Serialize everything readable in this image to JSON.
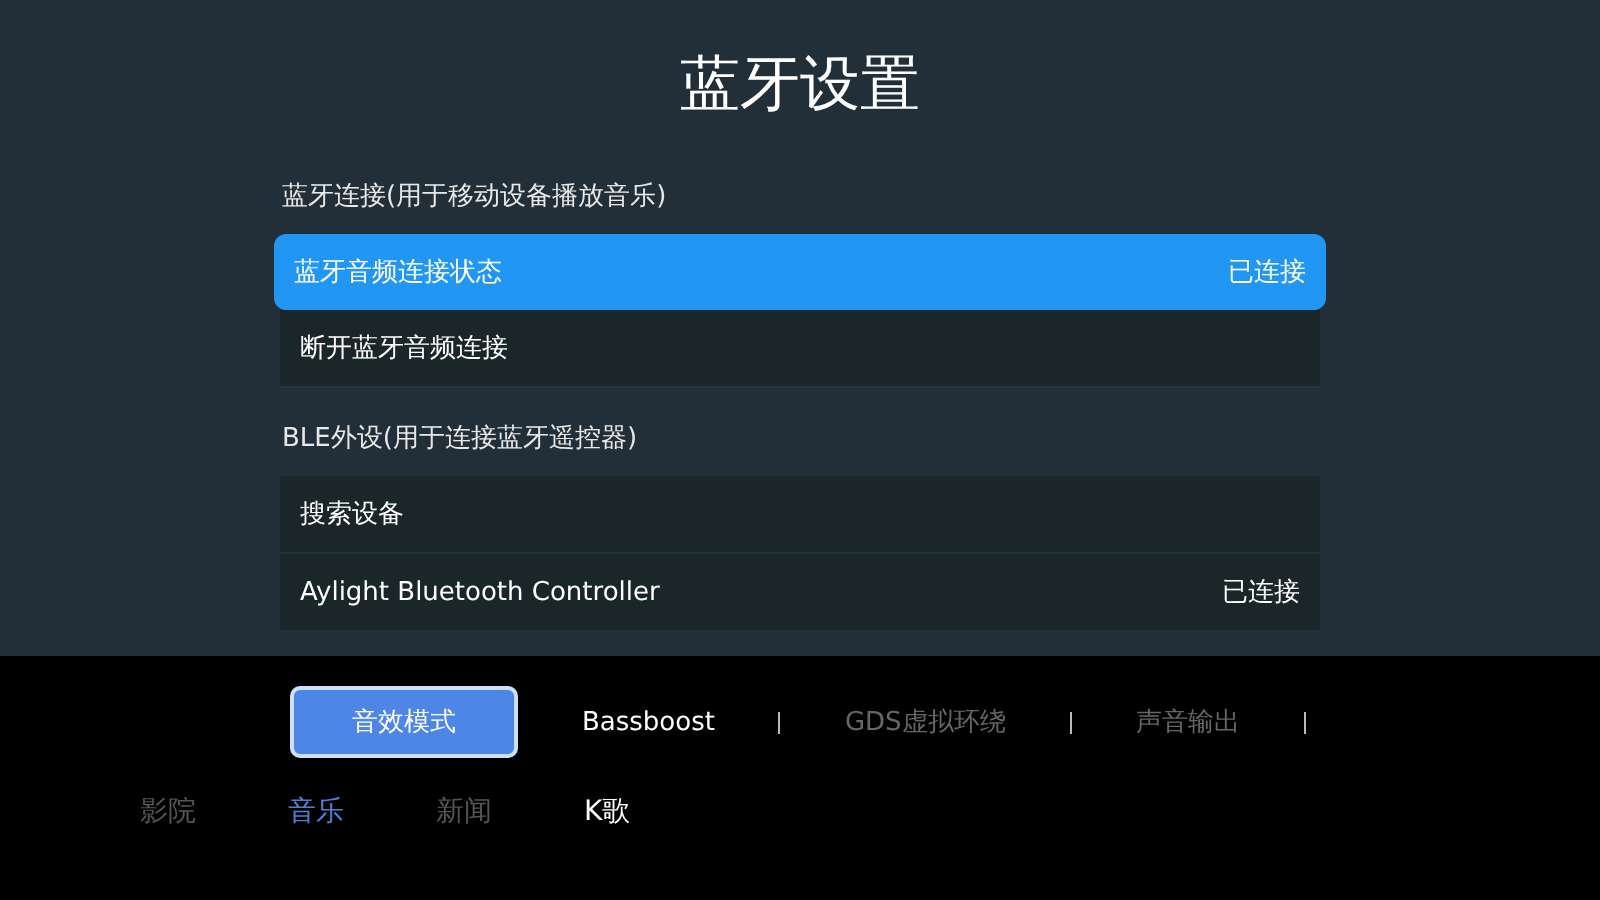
{
  "title": "蓝牙设置",
  "sections": [
    {
      "label": "蓝牙连接(用于移动设备播放音乐)",
      "rows": [
        {
          "label": "蓝牙音频连接状态",
          "value": "已连接",
          "selected": true
        },
        {
          "label": "断开蓝牙音频连接",
          "selected": false
        }
      ]
    },
    {
      "label": "BLE外设(用于连接蓝牙遥控器)",
      "rows": [
        {
          "label": "搜索设备",
          "selected": false
        },
        {
          "label": "Aylight Bluetooth Controller",
          "value": "已连接",
          "selected": false
        }
      ]
    }
  ],
  "sound_modes": [
    {
      "label": "音效模式",
      "selected": true,
      "highlighted": false
    },
    {
      "label": "Bassboost",
      "selected": false,
      "highlighted": true
    },
    {
      "label": "GDS虚拟环绕",
      "selected": false,
      "highlighted": false
    },
    {
      "label": "声音输出",
      "selected": false,
      "highlighted": false
    }
  ],
  "presets": [
    {
      "label": "影院",
      "selected": false,
      "highlighted": false
    },
    {
      "label": "音乐",
      "selected": true,
      "highlighted": false
    },
    {
      "label": "新闻",
      "selected": false,
      "highlighted": false
    },
    {
      "label": "K歌",
      "selected": false,
      "highlighted": true
    }
  ]
}
